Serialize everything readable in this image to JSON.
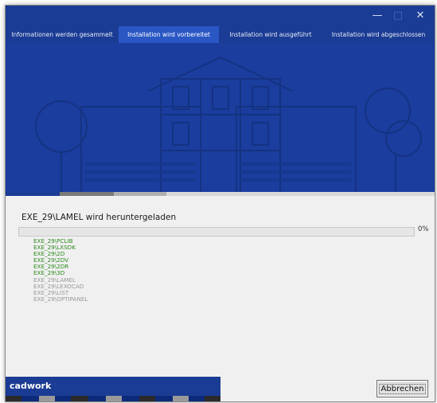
{
  "window": {
    "controls": {
      "minimize": "—",
      "maximize": "□",
      "close": "✕"
    }
  },
  "tabs": [
    {
      "label": "Informationen werden gesammelt",
      "active": false
    },
    {
      "label": "Installation wird vorbereitet",
      "active": true
    },
    {
      "label": "Installation wird ausgeführt",
      "active": false
    },
    {
      "label": "Installation wird abgeschlossen",
      "active": false
    }
  ],
  "steps_indicator": {
    "completed": 1,
    "current": 2,
    "total": 4
  },
  "status": {
    "message": "EXE_29\\LAMEL wird heruntergeladen",
    "progress_fraction": 0.0,
    "progress_text": "0%"
  },
  "log": [
    {
      "text": "EXE_29\\PCLIB",
      "state": "done"
    },
    {
      "text": "EXE_29\\LXSDK",
      "state": "done"
    },
    {
      "text": "EXE_29\\2D",
      "state": "done"
    },
    {
      "text": "EXE_29\\2DV",
      "state": "done"
    },
    {
      "text": "EXE_29\\2DR",
      "state": "done"
    },
    {
      "text": "EXE_29\\3D",
      "state": "done"
    },
    {
      "text": "EXE_29\\LAMEL",
      "state": "pending"
    },
    {
      "text": "EXE_29\\LEXOCAD",
      "state": "pending"
    },
    {
      "text": "EXE_29\\LIST",
      "state": "pending"
    },
    {
      "text": "EXE_29\\OPTIPANEL",
      "state": "pending"
    }
  ],
  "footer": {
    "brand": "cadwork",
    "cancel_label": "Abbrechen"
  },
  "colors": {
    "titlebar": "#1b3c94",
    "active_tab": "#2a57c4",
    "banner": "#1a3d9e",
    "done_text": "#2e8b1e",
    "pending_text": "#9a9a9a"
  }
}
